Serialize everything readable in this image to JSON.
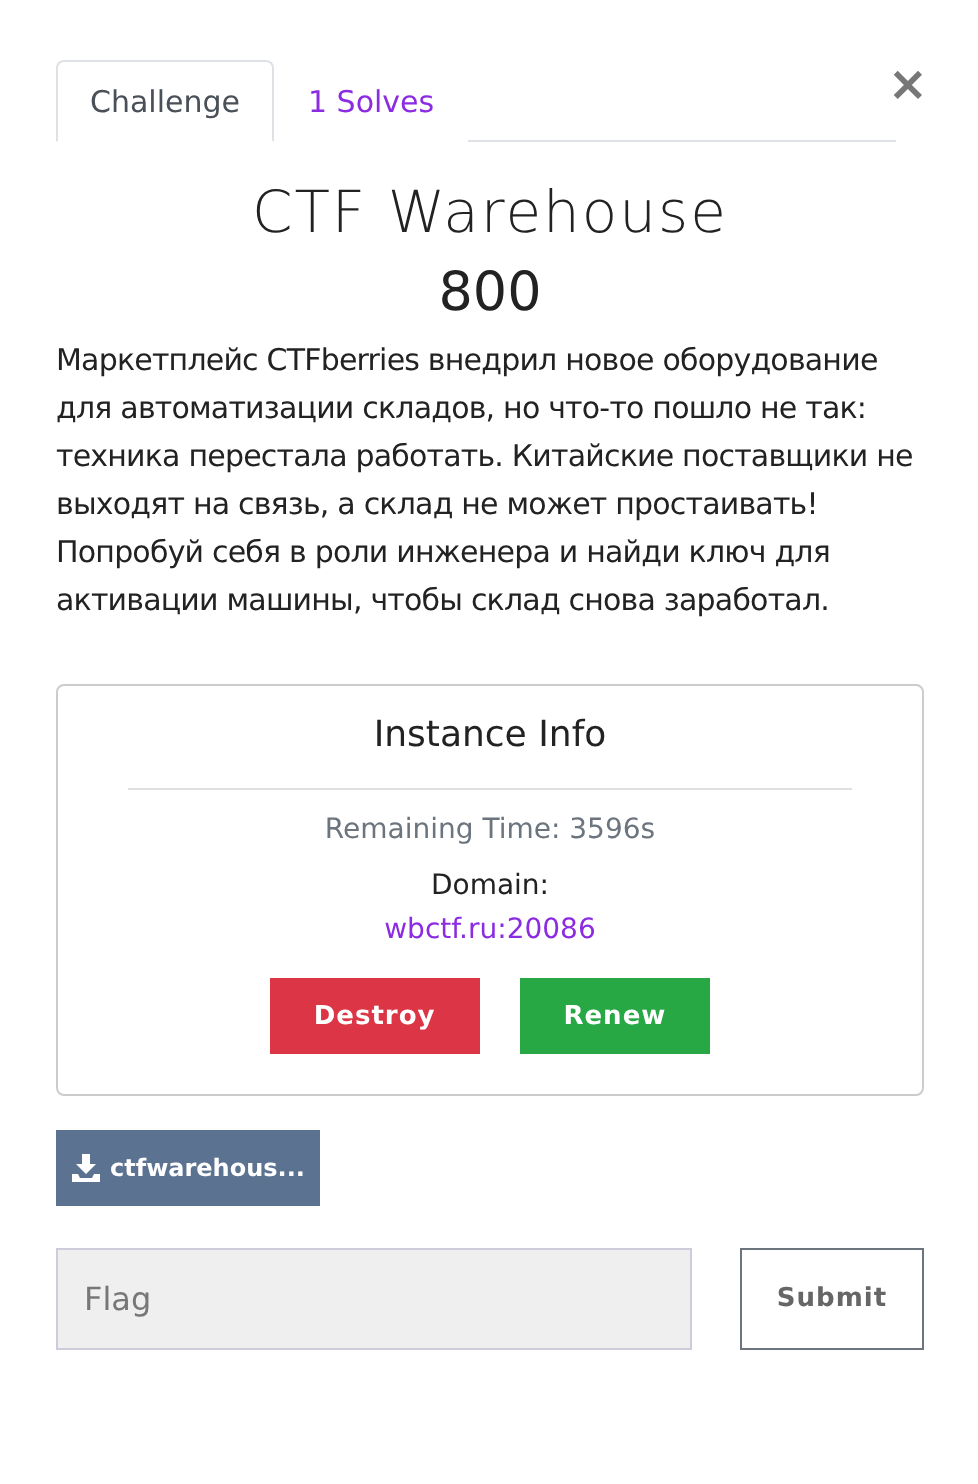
{
  "close": "×",
  "tabs": [
    {
      "label": "Challenge",
      "selected": true
    },
    {
      "label": "1 Solves",
      "selected": false
    }
  ],
  "title": "CTF Warehouse",
  "points": "800",
  "description": "Маркетплейс CTFberries внедрил новое оборудование для автоматизации складов, но что-то пошло не так: техника перестала работать. Китайские поставщики не выходят на связь, а склад не может простаивать! Попробуй себя в роли инженера и найди ключ для активации машины, чтобы склад снова заработал.",
  "instance": {
    "title": "Instance Info",
    "remaining": "Remaining Time: 3596s",
    "domain_label": "Domain:",
    "domain": "wbctf.ru:20086",
    "buttons": [
      {
        "label": "Destroy",
        "kind": "danger"
      },
      {
        "label": "Renew",
        "kind": "success"
      }
    ]
  },
  "file": {
    "label": "ctfwarehous..."
  },
  "flag": {
    "placeholder": "Flag"
  },
  "submit": "Submit"
}
